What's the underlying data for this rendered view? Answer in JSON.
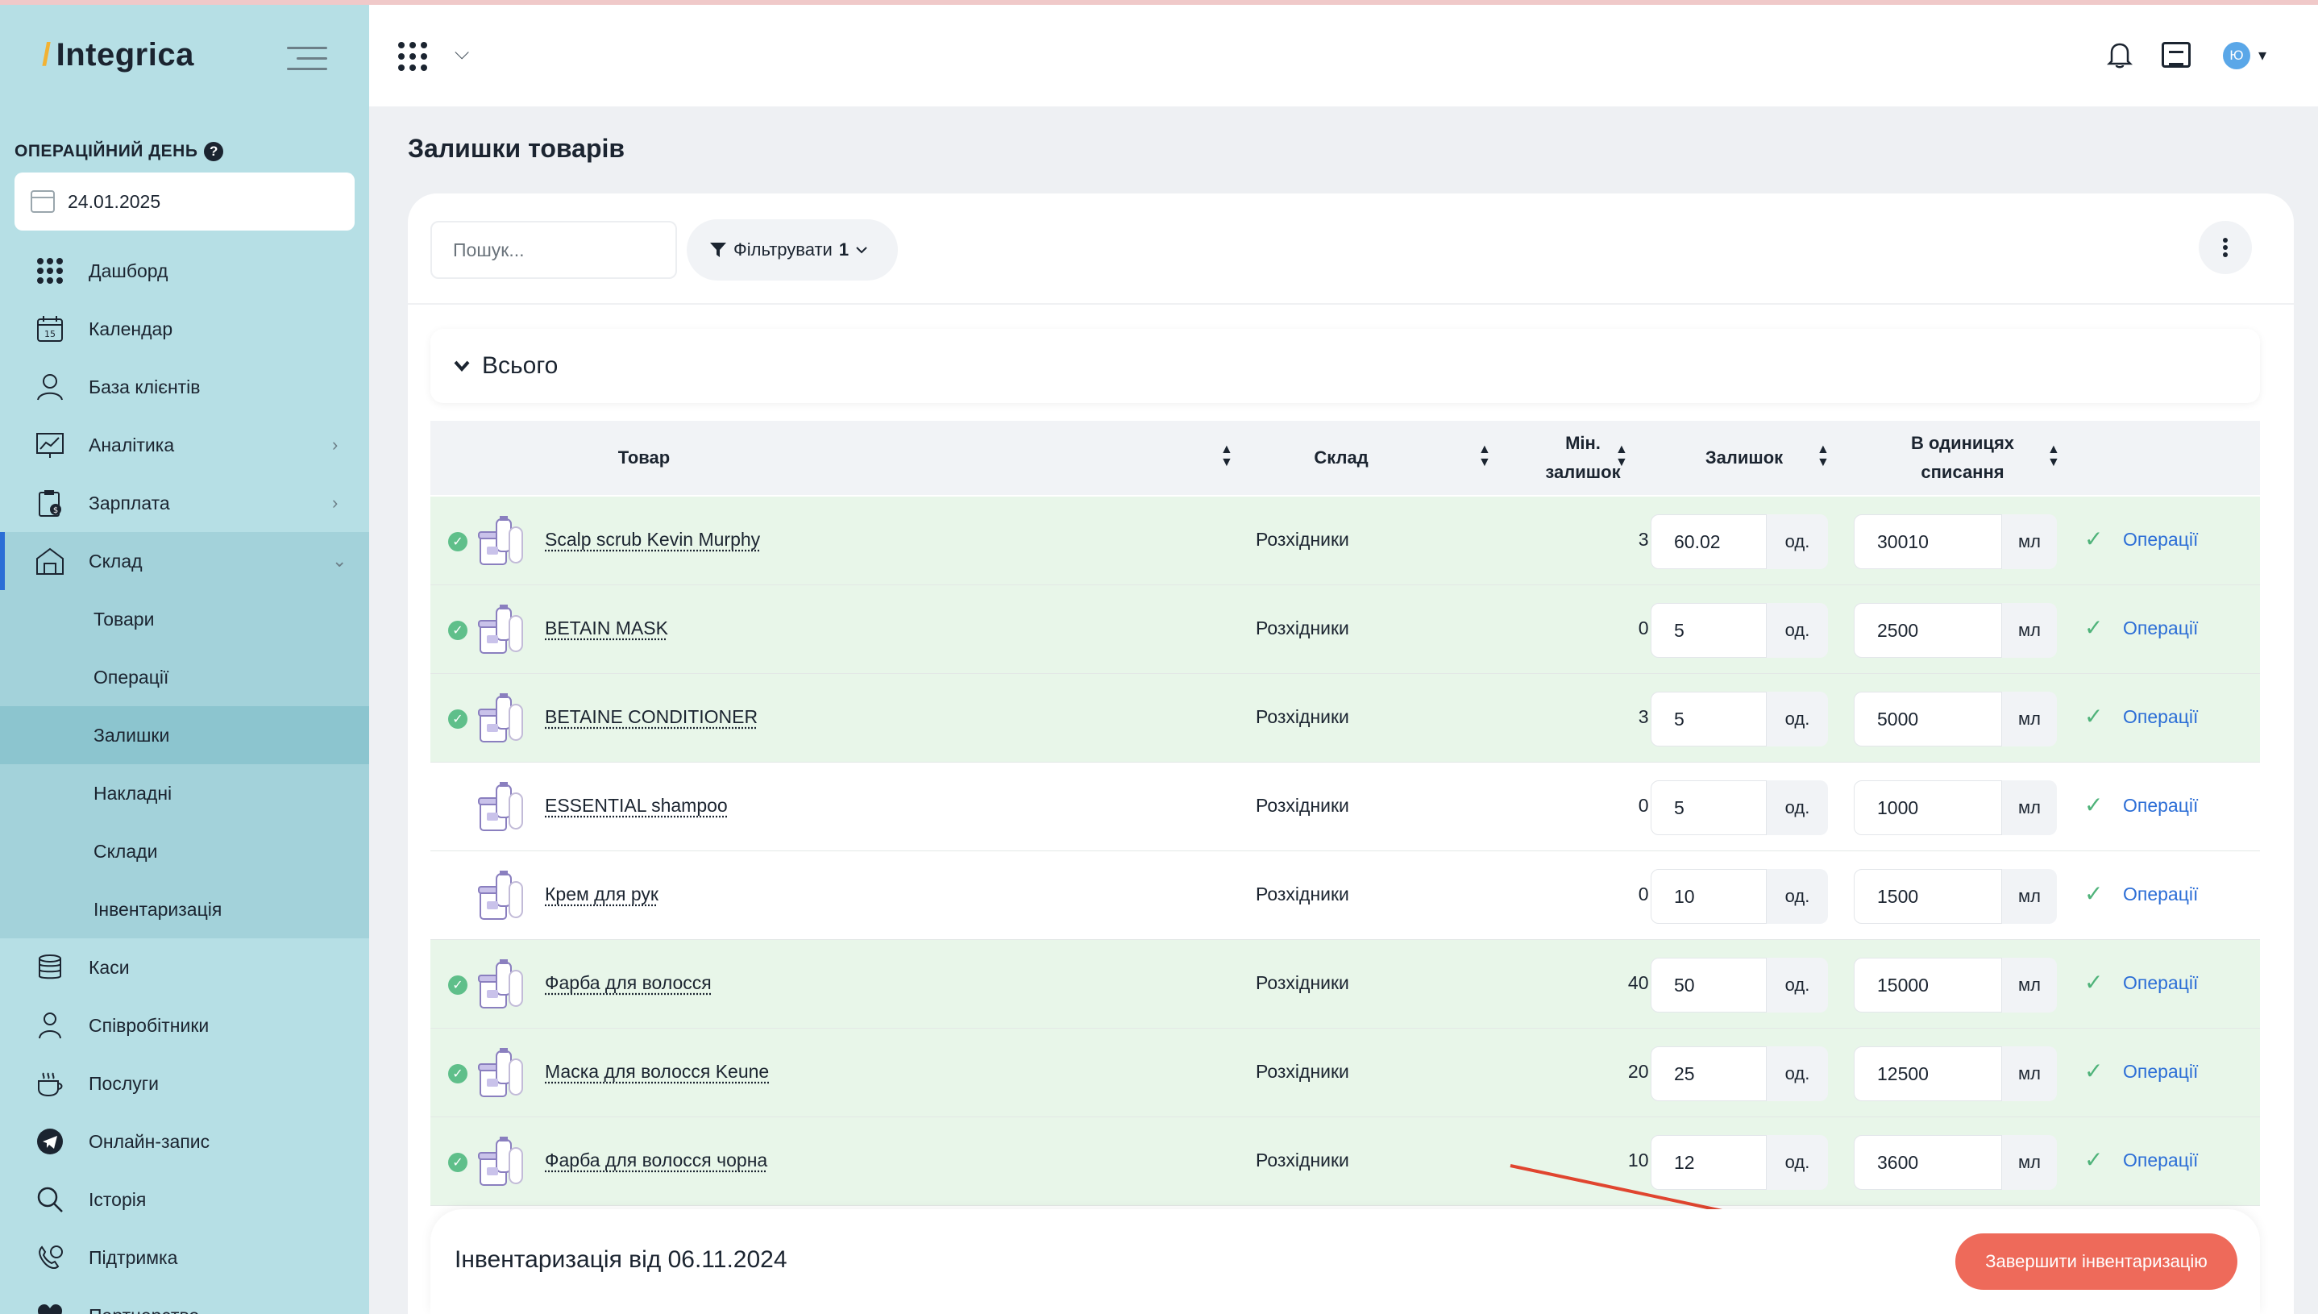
{
  "app": {
    "logo": "Integrica"
  },
  "sidebar": {
    "opday_label": "ОПЕРАЦІЙНИЙ ДЕНЬ",
    "help_icon": "?",
    "date": "24.01.2025",
    "items": [
      {
        "label": "Дашборд",
        "icon": "grid-icon"
      },
      {
        "label": "Календар",
        "icon": "calendar-icon"
      },
      {
        "label": "База клієнтів",
        "icon": "clients-icon"
      },
      {
        "label": "Аналітика",
        "icon": "analytics-icon",
        "chevron": "›"
      },
      {
        "label": "Зарплата",
        "icon": "salary-icon",
        "chevron": "›"
      },
      {
        "label": "Склад",
        "icon": "warehouse-icon",
        "chevron": "⌄"
      },
      {
        "label": "Каси",
        "icon": "cash-icon"
      },
      {
        "label": "Співробітники",
        "icon": "staff-icon"
      },
      {
        "label": "Послуги",
        "icon": "services-icon"
      },
      {
        "label": "Онлайн-запис",
        "icon": "telegram-icon"
      },
      {
        "label": "Історія",
        "icon": "search-icon"
      },
      {
        "label": "Підтримка",
        "icon": "support-icon"
      },
      {
        "label": "Партнерство",
        "icon": "heart-icon"
      }
    ],
    "sub_items": [
      {
        "label": "Товари"
      },
      {
        "label": "Операції"
      },
      {
        "label": "Залишки"
      },
      {
        "label": "Накладні"
      },
      {
        "label": "Склади"
      },
      {
        "label": "Інвентаризація"
      }
    ]
  },
  "header": {
    "avatar_letter": "Ю",
    "chevron": "⌵",
    "caret": "▾"
  },
  "main": {
    "title": "Залишки товарів",
    "search_placeholder": "Пошук...",
    "filter_label": "Фільтрувати",
    "filter_count": "1",
    "total_label": "Всього",
    "columns": {
      "product": "Товар",
      "warehouse": "Склад",
      "min_1": "Мін.",
      "min_2": "залишок",
      "stock": "Залишок",
      "units_1": "В одиницях",
      "units_2": "списання"
    },
    "rows": [
      {
        "name": "Scalp scrub Kevin Murphy",
        "warehouse": "Розхідники",
        "min": "3 од.",
        "qty": "60.02",
        "qty_unit": "од.",
        "ml": "30010",
        "ml_unit": "мл",
        "ops": "Операції",
        "checked": true
      },
      {
        "name": "BETAIN MASK",
        "warehouse": "Розхідники",
        "min": "0 од.",
        "qty": "5",
        "qty_unit": "од.",
        "ml": "2500",
        "ml_unit": "мл",
        "ops": "Операції",
        "checked": true
      },
      {
        "name": "BETAINE CONDITIONER",
        "warehouse": "Розхідники",
        "min": "3 од.",
        "qty": "5",
        "qty_unit": "од.",
        "ml": "5000",
        "ml_unit": "мл",
        "ops": "Операції",
        "checked": true
      },
      {
        "name": "ESSENTIAL shampoo",
        "warehouse": "Розхідники",
        "min": "0 од.",
        "qty": "5",
        "qty_unit": "од.",
        "ml": "1000",
        "ml_unit": "мл",
        "ops": "Операції",
        "checked": false
      },
      {
        "name": "Крем для рук",
        "warehouse": "Розхідники",
        "min": "0 од.",
        "qty": "10",
        "qty_unit": "од.",
        "ml": "1500",
        "ml_unit": "мл",
        "ops": "Операції",
        "checked": false
      },
      {
        "name": "Фарба для волосся",
        "warehouse": "Розхідники",
        "min": "40 од.",
        "qty": "50",
        "qty_unit": "од.",
        "ml": "15000",
        "ml_unit": "мл",
        "ops": "Операції",
        "checked": true
      },
      {
        "name": "Маска для волосся Keune",
        "warehouse": "Розхідники",
        "min": "20 од.",
        "qty": "25",
        "qty_unit": "од.",
        "ml": "12500",
        "ml_unit": "мл",
        "ops": "Операції",
        "checked": true
      },
      {
        "name": "Фарба для волосся чорна",
        "warehouse": "Розхідники",
        "min": "10 од.",
        "qty": "12",
        "qty_unit": "од.",
        "ml": "3600",
        "ml_unit": "мл",
        "ops": "Операції",
        "checked": true
      }
    ],
    "footer_title": "Інвентаризація від 06.11.2024",
    "finish_button": "Завершити інвентаризацію"
  },
  "colors": {
    "sidebar": "#b6dfe5",
    "accent": "#2c6ed6",
    "finish": "#ee6a5a",
    "row_green": "#e8f6e9",
    "arrow": "#e0452f"
  }
}
